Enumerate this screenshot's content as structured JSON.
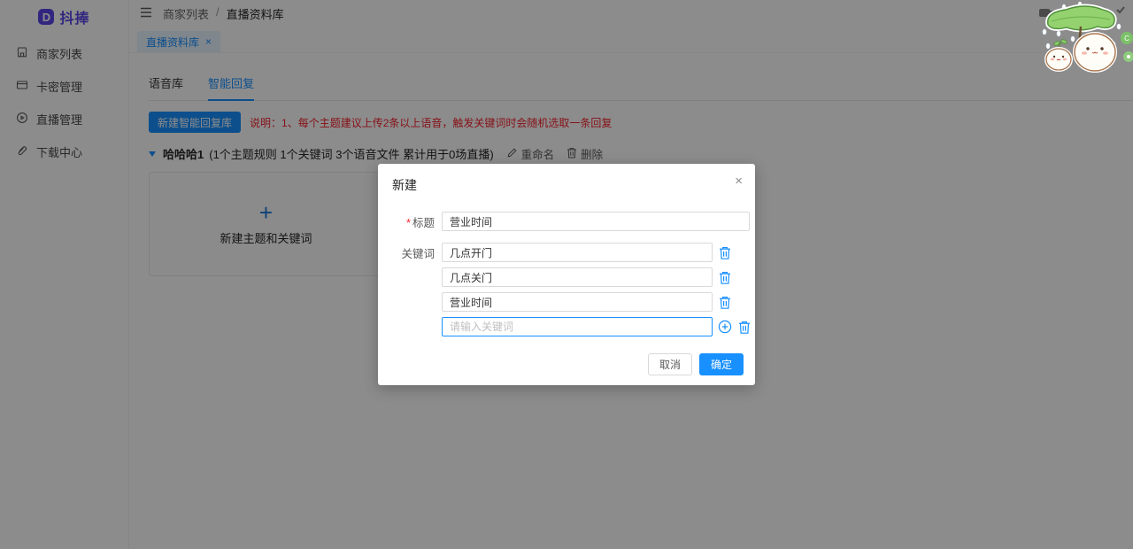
{
  "brand": {
    "name": "抖捧",
    "logo_letter": "D"
  },
  "sidebar": {
    "items": [
      {
        "icon": "shop-icon",
        "label": "商家列表"
      },
      {
        "icon": "credit-card-icon",
        "label": "卡密管理"
      },
      {
        "icon": "live-icon",
        "label": "直播管理"
      },
      {
        "icon": "paperclip-icon",
        "label": "下载中心"
      }
    ]
  },
  "header": {
    "breadcrumb": {
      "parent": "商家列表",
      "separator": "/",
      "current": "直播资料库"
    }
  },
  "tagbar": {
    "active_tag": "直播资料库",
    "close": "×"
  },
  "tabs": {
    "voice": "语音库",
    "smart": "智能回复"
  },
  "toolbar": {
    "new_button": "新建智能回复库",
    "note": "说明：1、每个主题建议上传2条以上语音，触发关键词时会随机选取一条回复"
  },
  "group": {
    "name": "哈哈哈1",
    "meta": "(1个主题规则 1个关键词 3个语音文件 累计用于0场直播)",
    "rename_label": "重命名",
    "delete_label": "删除"
  },
  "cards": {
    "plus": "+",
    "new_card_label": "新建主题和关键词"
  },
  "modal": {
    "title": "新建",
    "close": "×",
    "required_mark": "*",
    "title_label": "标题",
    "keyword_label": "关键词",
    "title_value": "营业时间",
    "keywords": [
      "几点开门",
      "几点关门",
      "营业时间"
    ],
    "keyword_placeholder": "请输入关键词",
    "cancel_label": "取消",
    "ok_label": "确定"
  },
  "colors": {
    "accent": "#1890ff",
    "brand_purple": "#5a46e8",
    "danger": "#f5222d",
    "tag_bg": "#e8f4ff"
  }
}
